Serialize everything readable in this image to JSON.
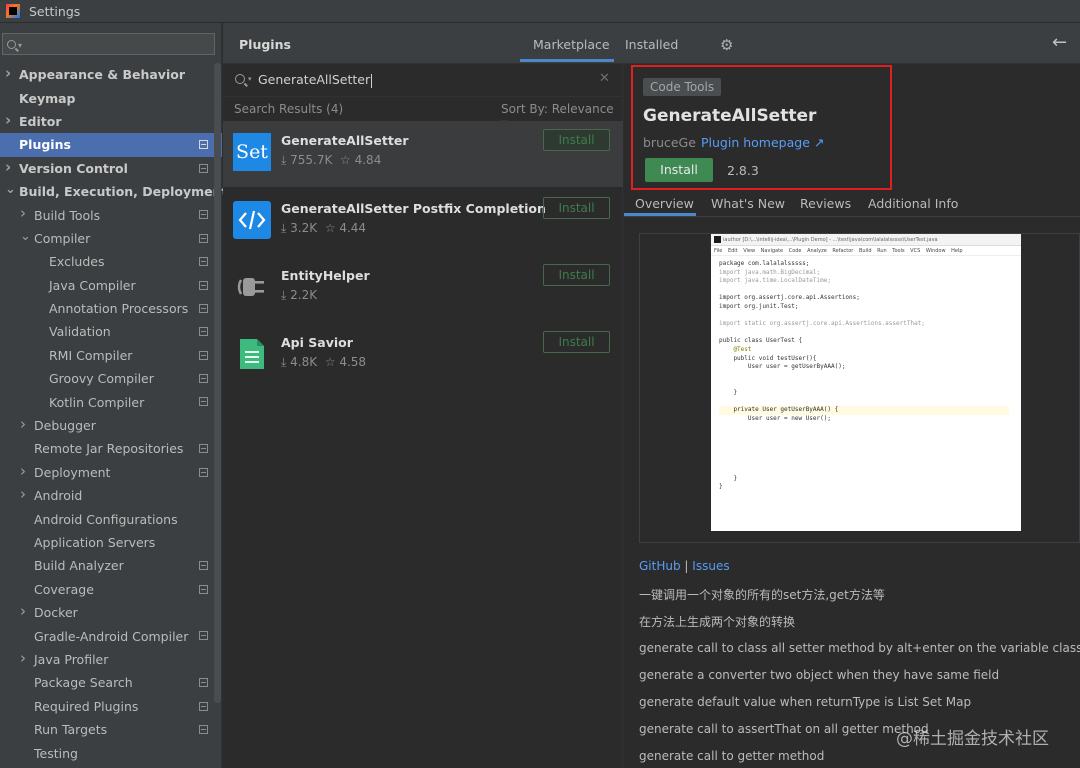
{
  "window": {
    "title": "Settings"
  },
  "left_panel": {
    "search_placeholder": "",
    "tree": [
      {
        "label": "Appearance & Behavior",
        "level": 0,
        "bold": true,
        "arrow": "right",
        "project": false,
        "selected": false
      },
      {
        "label": "Keymap",
        "level": 0,
        "bold": true,
        "arrow": "",
        "project": false,
        "selected": false
      },
      {
        "label": "Editor",
        "level": 0,
        "bold": true,
        "arrow": "right",
        "project": false,
        "selected": false
      },
      {
        "label": "Plugins",
        "level": 0,
        "bold": true,
        "arrow": "",
        "project": true,
        "selected": true
      },
      {
        "label": "Version Control",
        "level": 0,
        "bold": true,
        "arrow": "right",
        "project": true,
        "selected": false
      },
      {
        "label": "Build, Execution, Deployment",
        "level": 0,
        "bold": true,
        "arrow": "down",
        "project": false,
        "selected": false
      },
      {
        "label": "Build Tools",
        "level": 1,
        "bold": false,
        "arrow": "right",
        "project": true,
        "selected": false
      },
      {
        "label": "Compiler",
        "level": 1,
        "bold": false,
        "arrow": "down",
        "project": true,
        "selected": false
      },
      {
        "label": "Excludes",
        "level": 2,
        "bold": false,
        "arrow": "",
        "project": true,
        "selected": false
      },
      {
        "label": "Java Compiler",
        "level": 2,
        "bold": false,
        "arrow": "",
        "project": true,
        "selected": false
      },
      {
        "label": "Annotation Processors",
        "level": 2,
        "bold": false,
        "arrow": "",
        "project": true,
        "selected": false
      },
      {
        "label": "Validation",
        "level": 2,
        "bold": false,
        "arrow": "",
        "project": true,
        "selected": false
      },
      {
        "label": "RMI Compiler",
        "level": 2,
        "bold": false,
        "arrow": "",
        "project": true,
        "selected": false
      },
      {
        "label": "Groovy Compiler",
        "level": 2,
        "bold": false,
        "arrow": "",
        "project": true,
        "selected": false
      },
      {
        "label": "Kotlin Compiler",
        "level": 2,
        "bold": false,
        "arrow": "",
        "project": true,
        "selected": false
      },
      {
        "label": "Debugger",
        "level": 1,
        "bold": false,
        "arrow": "right",
        "project": false,
        "selected": false
      },
      {
        "label": "Remote Jar Repositories",
        "level": 1,
        "bold": false,
        "arrow": "",
        "project": true,
        "selected": false
      },
      {
        "label": "Deployment",
        "level": 1,
        "bold": false,
        "arrow": "right",
        "project": true,
        "selected": false
      },
      {
        "label": "Android",
        "level": 1,
        "bold": false,
        "arrow": "right",
        "project": false,
        "selected": false
      },
      {
        "label": "Android Configurations",
        "level": 1,
        "bold": false,
        "arrow": "",
        "project": false,
        "selected": false
      },
      {
        "label": "Application Servers",
        "level": 1,
        "bold": false,
        "arrow": "",
        "project": false,
        "selected": false
      },
      {
        "label": "Build Analyzer",
        "level": 1,
        "bold": false,
        "arrow": "",
        "project": true,
        "selected": false
      },
      {
        "label": "Coverage",
        "level": 1,
        "bold": false,
        "arrow": "",
        "project": true,
        "selected": false
      },
      {
        "label": "Docker",
        "level": 1,
        "bold": false,
        "arrow": "right",
        "project": false,
        "selected": false
      },
      {
        "label": "Gradle-Android Compiler",
        "level": 1,
        "bold": false,
        "arrow": "",
        "project": true,
        "selected": false
      },
      {
        "label": "Java Profiler",
        "level": 1,
        "bold": false,
        "arrow": "right",
        "project": false,
        "selected": false
      },
      {
        "label": "Package Search",
        "level": 1,
        "bold": false,
        "arrow": "",
        "project": true,
        "selected": false
      },
      {
        "label": "Required Plugins",
        "level": 1,
        "bold": false,
        "arrow": "",
        "project": true,
        "selected": false
      },
      {
        "label": "Run Targets",
        "level": 1,
        "bold": false,
        "arrow": "",
        "project": true,
        "selected": false
      },
      {
        "label": "Testing",
        "level": 1,
        "bold": false,
        "arrow": "",
        "project": false,
        "selected": false
      }
    ]
  },
  "header": {
    "title": "Plugins",
    "tabs": [
      "Marketplace",
      "Installed"
    ],
    "active_tab": "Marketplace",
    "gear_icon": "gear-icon",
    "back_icon": "back-arrow-icon"
  },
  "search": {
    "query": "GenerateAllSetter",
    "results_label": "Search Results (4)",
    "sort_label": "Sort By: Relevance"
  },
  "plugins": [
    {
      "name": "GenerateAllSetter",
      "downloads": "755.7K",
      "rating": "4.84",
      "install_label": "Install",
      "icon": "set-icon",
      "icon_text": "Set"
    },
    {
      "name": "GenerateAllSetter Postfix Completion",
      "downloads": "3.2K",
      "rating": "4.44",
      "install_label": "Install",
      "icon": "code-brackets-icon",
      "icon_text": ""
    },
    {
      "name": "EntityHelper",
      "downloads": "2.2K",
      "rating": "",
      "install_label": "Install",
      "icon": "plug-icon",
      "icon_text": ""
    },
    {
      "name": "Api Savior",
      "downloads": "4.8K",
      "rating": "4.58",
      "install_label": "Install",
      "icon": "document-icon",
      "icon_text": ""
    }
  ],
  "details": {
    "category": "Code Tools",
    "title": "GenerateAllSetter",
    "vendor": "bruceGe",
    "homepage_label": "Plugin homepage ↗",
    "install_label": "Install",
    "version": "2.8.3",
    "tabs": [
      "Overview",
      "What's New",
      "Reviews",
      "Additional Info"
    ],
    "active_tab": "Overview",
    "links": {
      "github": "GitHub",
      "separator": "|",
      "issues": "Issues"
    },
    "description_lines": [
      "一键调用一个对象的所有的set方法,get方法等",
      "在方法上生成两个对象的转换",
      "generate call to class all setter method by alt+enter on the variable class",
      "generate a converter two object when they have same field",
      "generate default value when returnType is List Set Map",
      "generate call to assertThat on all getter method",
      "generate call to getter method"
    ]
  },
  "screenshot_preview": {
    "window_title": "iauthor [D:\\...\\intellij-idea\\...\\Plugin Demo] - ...\\test\\java\\com\\lalalalsssss\\UserTest.java",
    "menu": "File Edit View Navigate Code Analyze Refactor Build Run Tools VCS Window Help",
    "code": [
      "package com.lalalalsssss;",
      "import java.math.BigDecimal;",
      "import java.time.LocalDateTime;",
      "",
      "import org.assertj.core.api.Assertions;",
      "import org.junit.Test;",
      "",
      "import static org.assertj.core.api.Assertions.assertThat;",
      "",
      "public class UserTest {",
      "    @Test",
      "    public void testUser(){",
      "        User user = getUserByAAA();",
      "",
      "",
      "    }",
      "",
      "    private User getUserByAAA() {",
      "        User user = new User();",
      "",
      "",
      "",
      "",
      "",
      "",
      "    }",
      "}"
    ]
  },
  "watermark": "@稀土掘金技术社区",
  "colors": {
    "accent": "#4a88c7",
    "selection": "#4b6eaf",
    "install_green": "#3e8a52",
    "link": "#589df6",
    "highlight_box": "#e02020"
  }
}
